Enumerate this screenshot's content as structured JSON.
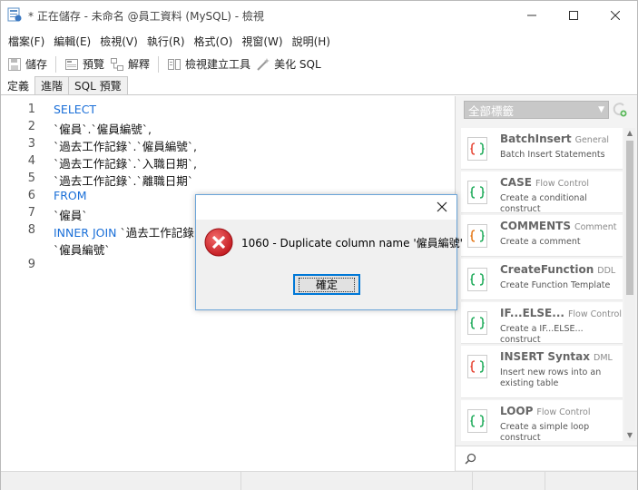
{
  "window": {
    "title": "* 正在儲存 - 未命名 @員工資料 (MySQL) - 檢視"
  },
  "menu": {
    "items": [
      {
        "label": "檔案(F)"
      },
      {
        "label": "編輯(E)"
      },
      {
        "label": "檢視(V)"
      },
      {
        "label": "執行(R)"
      },
      {
        "label": "格式(O)"
      },
      {
        "label": "視窗(W)"
      },
      {
        "label": "說明(H)"
      }
    ]
  },
  "toolbar": {
    "save_label": "儲存",
    "preview_label": "預覽",
    "explain_label": "解釋",
    "view_builder_label": "檢視建立工具",
    "beautify_label": "美化 SQL"
  },
  "tabs": [
    {
      "label": "定義",
      "active": true
    },
    {
      "label": "進階",
      "active": false
    },
    {
      "label": "SQL 預覽",
      "active": false
    }
  ],
  "editor": {
    "line_numbers": [
      "1",
      "2",
      "3",
      "4",
      "5",
      "6",
      "7",
      "8",
      "9"
    ],
    "lines": {
      "l1": "SELECT",
      "l2": "`僱員`.`僱員編號`,",
      "l3": "`過去工作記錄`.`僱員編號`,",
      "l4": "`過去工作記錄`.`入職日期`,",
      "l5": "`過去工作記錄`.`離職日期`",
      "l6": "FROM",
      "l7": "`僱員`",
      "l8_kw": "INNER JOIN",
      "l8_rest": " `過去工作記錄`",
      "l8b": "`僱員編號`"
    },
    "keyword_color": "#1a6fd8"
  },
  "right_panel": {
    "tag_filter": "全部標籤",
    "snippets": [
      {
        "name": "BatchInsert",
        "category": "General",
        "description": "Batch Insert Statements"
      },
      {
        "name": "CASE",
        "category": "Flow Control",
        "description": "Create a conditional construct"
      },
      {
        "name": "COMMENTS",
        "category": "Comment",
        "description": "Create a comment"
      },
      {
        "name": "CreateFunction",
        "category": "DDL",
        "description": "Create Function Template"
      },
      {
        "name": "IF...ELSE...",
        "category": "Flow Control",
        "description": "Create a IF...ELSE... construct"
      },
      {
        "name": "INSERT Syntax",
        "category": "DML",
        "description": "Insert new rows into an existing table"
      },
      {
        "name": "LOOP",
        "category": "Flow Control",
        "description": "Create a simple loop construct"
      }
    ]
  },
  "dialog": {
    "message": "1060 - Duplicate column name '僱員編號'",
    "ok_label": "確定",
    "border_color": "#6aa4d8",
    "error_color": "#d9252b"
  }
}
